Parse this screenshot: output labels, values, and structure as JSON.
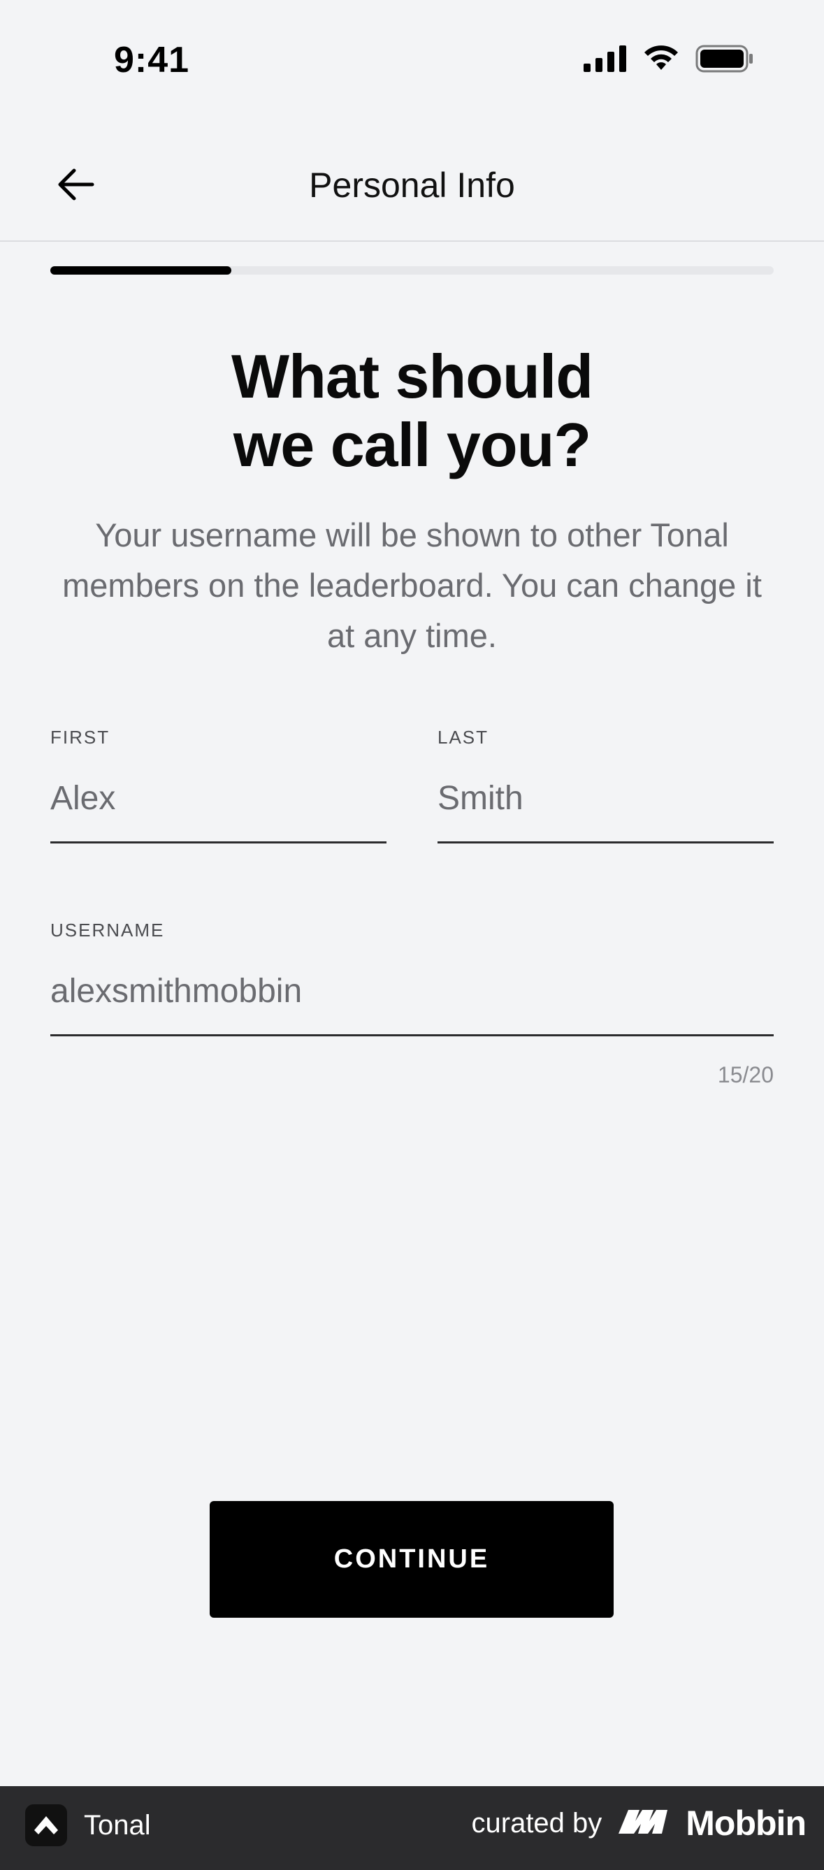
{
  "status_bar": {
    "time": "9:41",
    "icons": [
      "signal-icon",
      "wifi-icon",
      "battery-icon"
    ]
  },
  "nav": {
    "title": "Personal Info",
    "back_icon": "arrow-left-icon"
  },
  "progress": {
    "fraction": 0.25
  },
  "heading": {
    "line1": "What should",
    "line2": "we call you?"
  },
  "subtext": "Your username will be shown to other Tonal members on the leaderboard. You can change it at any time.",
  "form": {
    "first": {
      "label": "FIRST",
      "value": "Alex"
    },
    "last": {
      "label": "LAST",
      "value": "Smith"
    },
    "username": {
      "label": "USERNAME",
      "value": "alexsmithmobbin"
    },
    "counter": "15/20"
  },
  "continue_label": "CONTINUE",
  "footer": {
    "app_name": "Tonal",
    "curated_label": "curated by",
    "brand": "Mobbin"
  },
  "colors": {
    "background": "#f3f4f6",
    "primary": "#000000",
    "muted_text": "#6a6b70",
    "footer_bg": "#2b2b2d"
  }
}
